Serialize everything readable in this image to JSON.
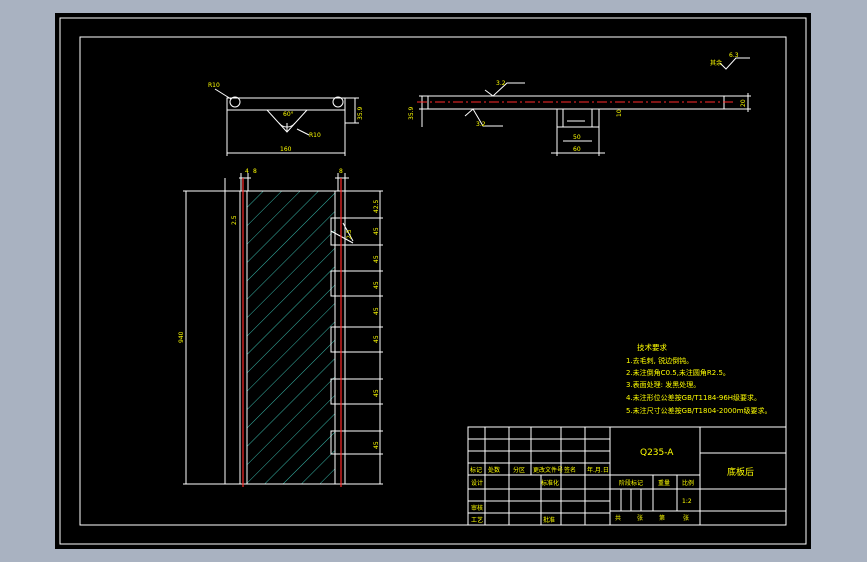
{
  "colors": {
    "window_bg": "#a9b2c1",
    "canvas_bg": "#000000",
    "line": "#ffffff",
    "dim": "#ffffff",
    "accent_red": "#ff2a2a",
    "text_yellow": "#ffff00",
    "hatch": "#37b6a8"
  },
  "front_view": {
    "top_dims": [
      "4",
      "8",
      "8"
    ],
    "left_dim": "2.5",
    "right_dims": [
      "42.5",
      "45",
      "45",
      "45",
      "45",
      "45",
      "45",
      "45"
    ],
    "notch_label": "2.5",
    "overall_height": "940"
  },
  "top_left_view": {
    "radius_label": "R10",
    "width_label": "160",
    "height_label": "35.9",
    "angle_label": "60°",
    "small_radius_label": "R10"
  },
  "top_right_view": {
    "roughness_top": "3.2",
    "roughness_bottom": "3.2",
    "left_height_label": "35.9",
    "right_label": "20",
    "slot_label_inner": "50",
    "slot_label_outer": "60",
    "slot_height_label": "10"
  },
  "roughness_other": {
    "label": "其余",
    "value": "6.3"
  },
  "tech_notes": {
    "title": "技术要求",
    "items": [
      "1.去毛刺, 锐边倒钝。",
      "2.未注倒角C0.5,未注圆角R2.5。",
      "3.表面处理: 发黑处理。",
      "4.未注形位公差按GB/T1184-96H级要求。",
      "5.未注尺寸公差按GB/T1804-2000m级要求。"
    ]
  },
  "title_block": {
    "material": "Q235-A",
    "part_name": "底板后",
    "header_cells": [
      "标记",
      "处数",
      "分区",
      "更改文件号",
      "签名",
      "年.月.日"
    ],
    "row_labels": {
      "design": "设计",
      "standardize": "标准化",
      "review": "审核",
      "process": "工艺",
      "approve": "批准"
    },
    "stage_label": "阶段标记",
    "weight_label": "重量",
    "scale_label": "比例",
    "scale_value": "1:2",
    "sheets_text": [
      "共",
      "张",
      "第",
      "张"
    ]
  }
}
